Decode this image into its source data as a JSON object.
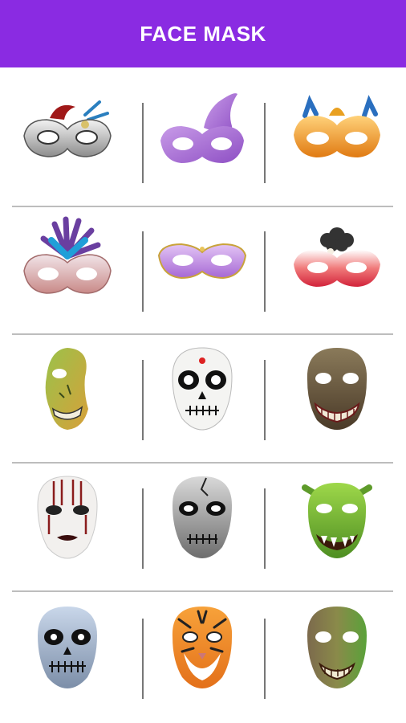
{
  "app_bar": {
    "title": "FACE MASK"
  },
  "masks": [
    {
      "icon": "silver-masquerade-mask-icon"
    },
    {
      "icon": "purple-glitter-masquerade-mask-icon"
    },
    {
      "icon": "gold-orange-masquerade-mask-icon"
    },
    {
      "icon": "feathered-pink-masquerade-mask-icon"
    },
    {
      "icon": "lilac-gold-masquerade-mask-icon"
    },
    {
      "icon": "red-feather-masquerade-mask-icon"
    },
    {
      "icon": "green-zombie-half-face-mask-icon"
    },
    {
      "icon": "sugar-skull-mask-icon"
    },
    {
      "icon": "grinning-monster-mask-icon"
    },
    {
      "icon": "white-slashed-face-mask-icon"
    },
    {
      "icon": "cracked-skull-face-mask-icon"
    },
    {
      "icon": "green-goblin-mask-icon"
    },
    {
      "icon": "blue-skull-mask-icon"
    },
    {
      "icon": "tiger-face-mask-icon"
    },
    {
      "icon": "rotting-zombie-face-mask-icon"
    }
  ],
  "colors": {
    "header": "#8a2be2",
    "title": "#ffffff"
  }
}
